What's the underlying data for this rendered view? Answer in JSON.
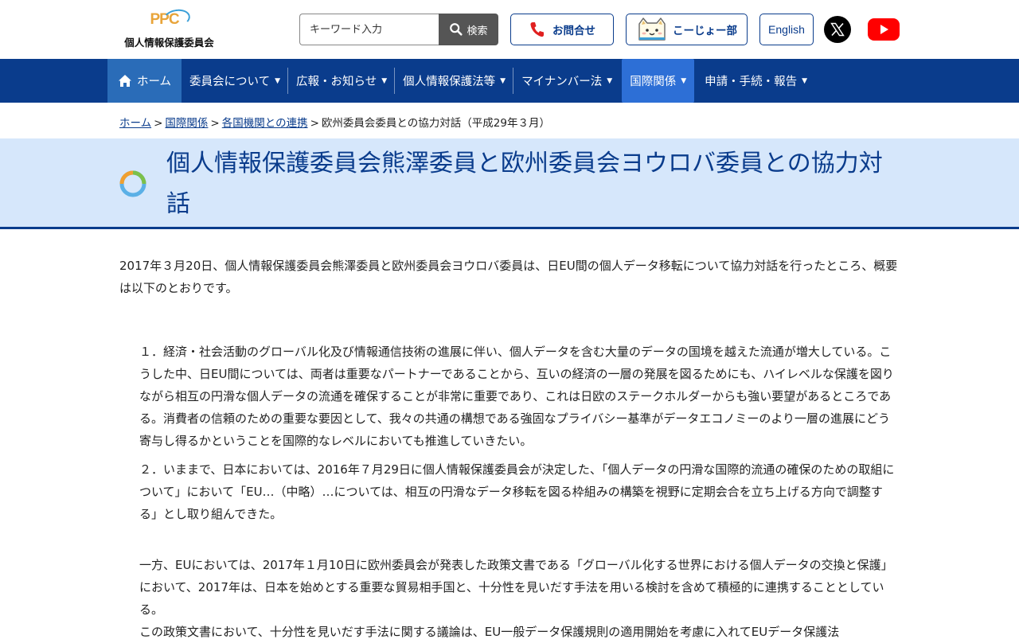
{
  "header": {
    "logo_mark": "PPC",
    "logo_text": "個人情報保護委員会",
    "search": {
      "placeholder": "キーワード入力",
      "button_label": "検索"
    },
    "contact_label": "お問合せ",
    "kids_label": "こーじょー部",
    "english_label": "English"
  },
  "nav": {
    "items": [
      {
        "label": "ホーム"
      },
      {
        "label": "委員会について"
      },
      {
        "label": "広報・お知らせ"
      },
      {
        "label": "個人情報保護法等"
      },
      {
        "label": "マイナンバー法"
      },
      {
        "label": "国際関係"
      },
      {
        "label": "申請・手続・報告"
      }
    ],
    "caret": "▼"
  },
  "breadcrumb": {
    "items": [
      "ホーム",
      "国際関係",
      "各国機関との連携"
    ],
    "current": "欧州委員会委員との協力対話（平成29年３月）",
    "separator": ">"
  },
  "page": {
    "title": "個人情報保護委員会熊澤委員と欧州委員会ヨウロバ委員との協力対話",
    "intro": "2017年３月20日、個人情報保護委員会熊澤委員と欧州委員会ヨウロバ委員は、日EU間の個人データ移転について協力対話を行ったところ、概要は以下のとおりです。",
    "paragraphs": [
      "１．経済・社会活動のグローバル化及び情報通信技術の進展に伴い、個人データを含む大量のデータの国境を越えた流通が増大している。こうした中、日EU間については、両者は重要なパートナーであることから、互いの経済の一層の発展を図るためにも、ハイレベルな保護を図りながら相互の円滑な個人データの流通を確保することが非常に重要であり、これは日欧のステークホルダーからも強い要望があるところである。消費者の信頼のための重要な要因として、我々の共通の構想である強固なプライバシー基準がデータエコノミーのより一層の進展にどう寄与し得るかということを国際的なレベルにおいても推進していきたい。",
      "２．いままで、日本においては、2016年７月29日に個人情報保護委員会が決定した、「個人データの円滑な国際的流通の確保のための取組について」において「EU…（中略）…については、相互の円滑なデータ移転を図る枠組みの構築を視野に定期会合を立ち上げる方向で調整する」とし取り組んできた。",
      "一方、EUにおいては、2017年１月10日に欧州委員会が発表した政策文書である「グローバル化する世界における個人データの交換と保護」において、2017年は、日本を始めとする重要な貿易相手国と、十分性を見いだす手法を用いる検討を含めて積極的に連携することとしている。",
      "この政策文書において、十分性を見いだす手法に関する議論は、EU一般データ保護規則の適用開始を考慮に入れてEUデータ保護法"
    ]
  },
  "colors": {
    "primary": "#0a3c8c",
    "nav_home": "#2a6cb8",
    "nav_active": "#2d6fd6",
    "title_band": "#d6e7fb"
  }
}
